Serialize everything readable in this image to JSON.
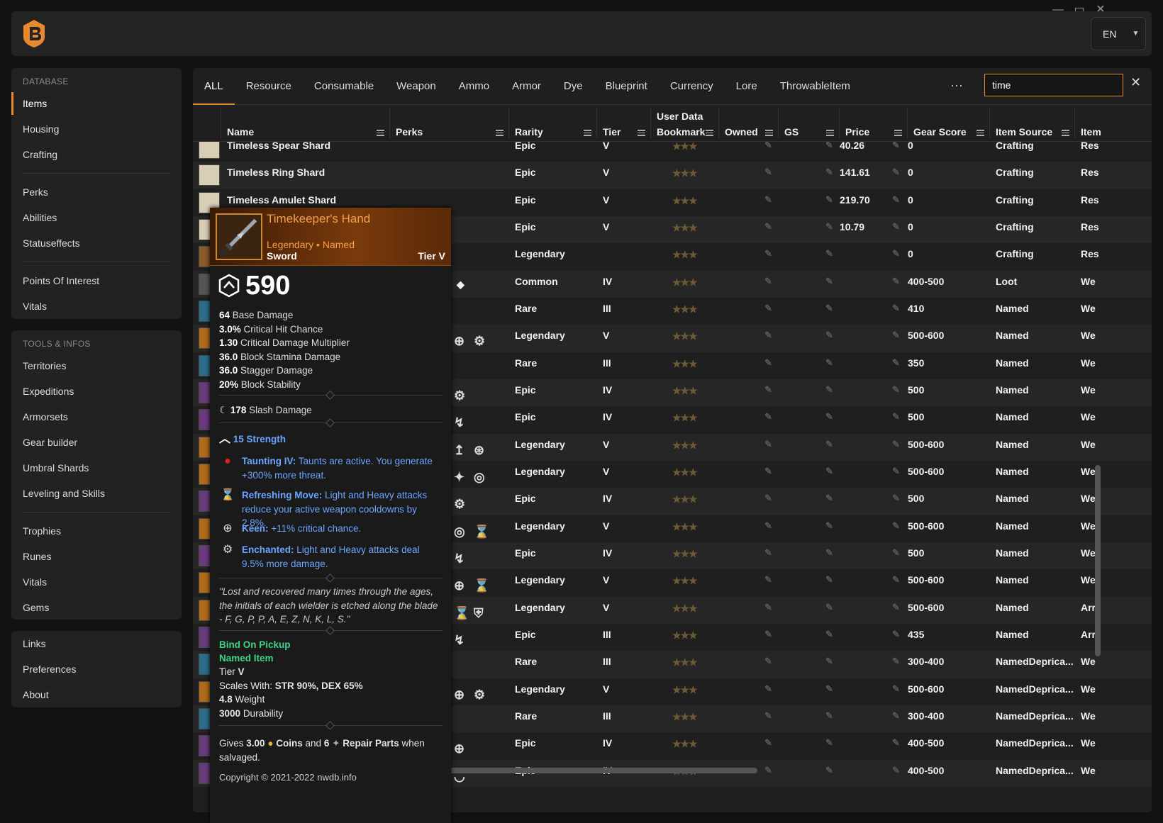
{
  "window": {
    "minimize": "—",
    "maximize": "▭",
    "close": "✕"
  },
  "header": {
    "lang": "EN"
  },
  "sidebar": {
    "database_title": "DATABASE",
    "database_items": [
      "Items",
      "Housing",
      "Crafting"
    ],
    "database_items2": [
      "Perks",
      "Abilities",
      "Statuseffects"
    ],
    "database_items3": [
      "Points Of Interest",
      "Vitals"
    ],
    "tools_title": "TOOLS & INFOS",
    "tools_items": [
      "Territories",
      "Expeditions",
      "Armorsets",
      "Gear builder",
      "Umbral Shards",
      "Leveling and Skills"
    ],
    "tools_items2": [
      "Trophies",
      "Runes",
      "Vitals",
      "Gems"
    ],
    "bottom_items": [
      "Links",
      "Preferences",
      "About"
    ]
  },
  "tabs": [
    "ALL",
    "Resource",
    "Consumable",
    "Weapon",
    "Ammo",
    "Armor",
    "Dye",
    "Blueprint",
    "Currency",
    "Lore",
    "ThrowableItem"
  ],
  "search": {
    "value": "time",
    "more": "···",
    "clear": "✕"
  },
  "columns": {
    "group_user_data": "User Data",
    "name": "Name",
    "perks": "Perks",
    "rarity": "Rarity",
    "tier": "Tier",
    "bookmark": "Bookmark",
    "owned": "Owned",
    "gs": "GS",
    "price": "Price",
    "gear_score": "Gear Score",
    "item_source": "Item Source",
    "item_type": "Item"
  },
  "rows": [
    {
      "name": "Timeless Spear Shard",
      "rarity": "Epic",
      "tier": "V",
      "price": "40.26",
      "gear_score": "0",
      "source": "Crafting",
      "type": "Res",
      "icon": "#d9cdb6"
    },
    {
      "name": "Timeless Ring Shard",
      "rarity": "Epic",
      "tier": "V",
      "price": "141.61",
      "gear_score": "0",
      "source": "Crafting",
      "type": "Res",
      "icon": "#d9cdb6"
    },
    {
      "name": "Timeless Amulet Shard",
      "rarity": "Epic",
      "tier": "V",
      "price": "219.70",
      "gear_score": "0",
      "source": "Crafting",
      "type": "Res",
      "icon": "#d9cdb6"
    },
    {
      "name": "",
      "rarity": "Epic",
      "tier": "V",
      "price": "10.79",
      "gear_score": "0",
      "source": "Crafting",
      "type": "Res",
      "icon": "#d9cdb6"
    },
    {
      "name": "",
      "rarity": "Legendary",
      "tier": "",
      "price": "",
      "gear_score": "0",
      "source": "Crafting",
      "type": "Res",
      "icon": "#8a5a2a"
    },
    {
      "name": "",
      "rarity": "Common",
      "tier": "IV",
      "price": "",
      "gear_score": "400-500",
      "source": "Loot",
      "type": "We",
      "icon": "#555"
    },
    {
      "name": "",
      "rarity": "Rare",
      "tier": "III",
      "price": "",
      "gear_score": "410",
      "source": "Named",
      "type": "We",
      "icon": "#2c6e8a"
    },
    {
      "name": "",
      "rarity": "Legendary",
      "tier": "V",
      "price": "",
      "gear_score": "500-600",
      "source": "Named",
      "type": "We",
      "icon": "#b06a1a"
    },
    {
      "name": "",
      "rarity": "Rare",
      "tier": "III",
      "price": "",
      "gear_score": "350",
      "source": "Named",
      "type": "We",
      "icon": "#2c6e8a"
    },
    {
      "name": "",
      "rarity": "Epic",
      "tier": "IV",
      "price": "",
      "gear_score": "500",
      "source": "Named",
      "type": "We",
      "icon": "#6a3a7a"
    },
    {
      "name": "",
      "rarity": "Epic",
      "tier": "IV",
      "price": "",
      "gear_score": "500",
      "source": "Named",
      "type": "We",
      "icon": "#6a3a7a"
    },
    {
      "name": "",
      "rarity": "Legendary",
      "tier": "V",
      "price": "",
      "gear_score": "500-600",
      "source": "Named",
      "type": "We",
      "icon": "#b06a1a"
    },
    {
      "name": "",
      "rarity": "Legendary",
      "tier": "V",
      "price": "",
      "gear_score": "500-600",
      "source": "Named",
      "type": "We",
      "icon": "#b06a1a"
    },
    {
      "name": "",
      "rarity": "Epic",
      "tier": "IV",
      "price": "",
      "gear_score": "500",
      "source": "Named",
      "type": "We",
      "icon": "#6a3a7a"
    },
    {
      "name": "",
      "rarity": "Legendary",
      "tier": "V",
      "price": "",
      "gear_score": "500-600",
      "source": "Named",
      "type": "We",
      "icon": "#b06a1a"
    },
    {
      "name": "",
      "rarity": "Epic",
      "tier": "IV",
      "price": "",
      "gear_score": "500",
      "source": "Named",
      "type": "We",
      "icon": "#6a3a7a"
    },
    {
      "name": "",
      "rarity": "Legendary",
      "tier": "V",
      "price": "",
      "gear_score": "500-600",
      "source": "Named",
      "type": "We",
      "icon": "#b06a1a"
    },
    {
      "name": "",
      "rarity": "Legendary",
      "tier": "V",
      "price": "",
      "gear_score": "500-600",
      "source": "Named",
      "type": "Arr",
      "icon": "#b06a1a"
    },
    {
      "name": "",
      "rarity": "Epic",
      "tier": "III",
      "price": "",
      "gear_score": "435",
      "source": "Named",
      "type": "Arr",
      "icon": "#6a3a7a"
    },
    {
      "name": "",
      "rarity": "Rare",
      "tier": "III",
      "price": "",
      "gear_score": "300-400",
      "source": "NamedDeprica...",
      "type": "We",
      "icon": "#2c6e8a"
    },
    {
      "name": "",
      "rarity": "Legendary",
      "tier": "V",
      "price": "",
      "gear_score": "500-600",
      "source": "NamedDeprica...",
      "type": "We",
      "icon": "#b06a1a"
    },
    {
      "name": "",
      "rarity": "Rare",
      "tier": "III",
      "price": "",
      "gear_score": "300-400",
      "source": "NamedDeprica...",
      "type": "We",
      "icon": "#2c6e8a"
    },
    {
      "name": "",
      "rarity": "Epic",
      "tier": "IV",
      "price": "",
      "gear_score": "400-500",
      "source": "NamedDeprica...",
      "type": "We",
      "icon": "#6a3a7a"
    },
    {
      "name": "",
      "rarity": "Epic",
      "tier": "IV",
      "price": "",
      "gear_score": "400-500",
      "source": "NamedDeprica...",
      "type": "We",
      "icon": "#6a3a7a"
    }
  ],
  "tooltip": {
    "name": "Timekeeper's Hand",
    "rarity_line": "Legendary • Named",
    "type": "Sword",
    "tier": "Tier V",
    "gear_score": "590",
    "stats": [
      {
        "value": "64",
        "label": "Base Damage"
      },
      {
        "value": "3.0%",
        "label": "Critical Hit Chance"
      },
      {
        "value": "1.30",
        "label": "Critical Damage Multiplier"
      },
      {
        "value": "36.0",
        "label": "Block Stamina Damage"
      },
      {
        "value": "36.0",
        "label": "Stagger Damage"
      },
      {
        "value": "20%",
        "label": "Block Stability"
      }
    ],
    "slash_value": "178",
    "slash_label": "Slash Damage",
    "attribute": "15 Strength",
    "perks": [
      {
        "name": "Taunting IV:",
        "text": "Taunts are active. You generate +300% more threat."
      },
      {
        "name": "Refreshing Move:",
        "text": "Light and Heavy attacks reduce your active weapon cooldowns by 2.8%."
      },
      {
        "name": "Keen:",
        "text": "+11% critical chance."
      },
      {
        "name": "Enchanted:",
        "text": "Light and Heavy attacks deal 9.5% more damage."
      }
    ],
    "flavor": "\"Lost and recovered many times through the ages, the initials of each wielder is etched along the blade - F, G, P, P, A, E, Z, N, K, L, S.\"",
    "bind": "Bind On Pickup",
    "named": "Named Item",
    "tier_label": "Tier",
    "tier_value": "V",
    "scales_label": "Scales With:",
    "scales_value": "STR 90%, DEX 65%",
    "weight_value": "4.8",
    "weight_label": "Weight",
    "durability_value": "3000",
    "durability_label": "Durability",
    "salvage_prefix": "Gives",
    "salvage_coins_value": "3.00",
    "salvage_coins": "Coins",
    "salvage_and": "and",
    "salvage_parts_value": "6",
    "salvage_parts": "Repair Parts",
    "salvage_suffix": "when salvaged."
  },
  "footer": {
    "copyright": "Copyright © 2021-2022 nwdb.info"
  },
  "colors": {
    "accent": "#e8892e",
    "legendary": "#f4a04a",
    "perk": "#6aa6ff",
    "green": "#3fd48a"
  }
}
